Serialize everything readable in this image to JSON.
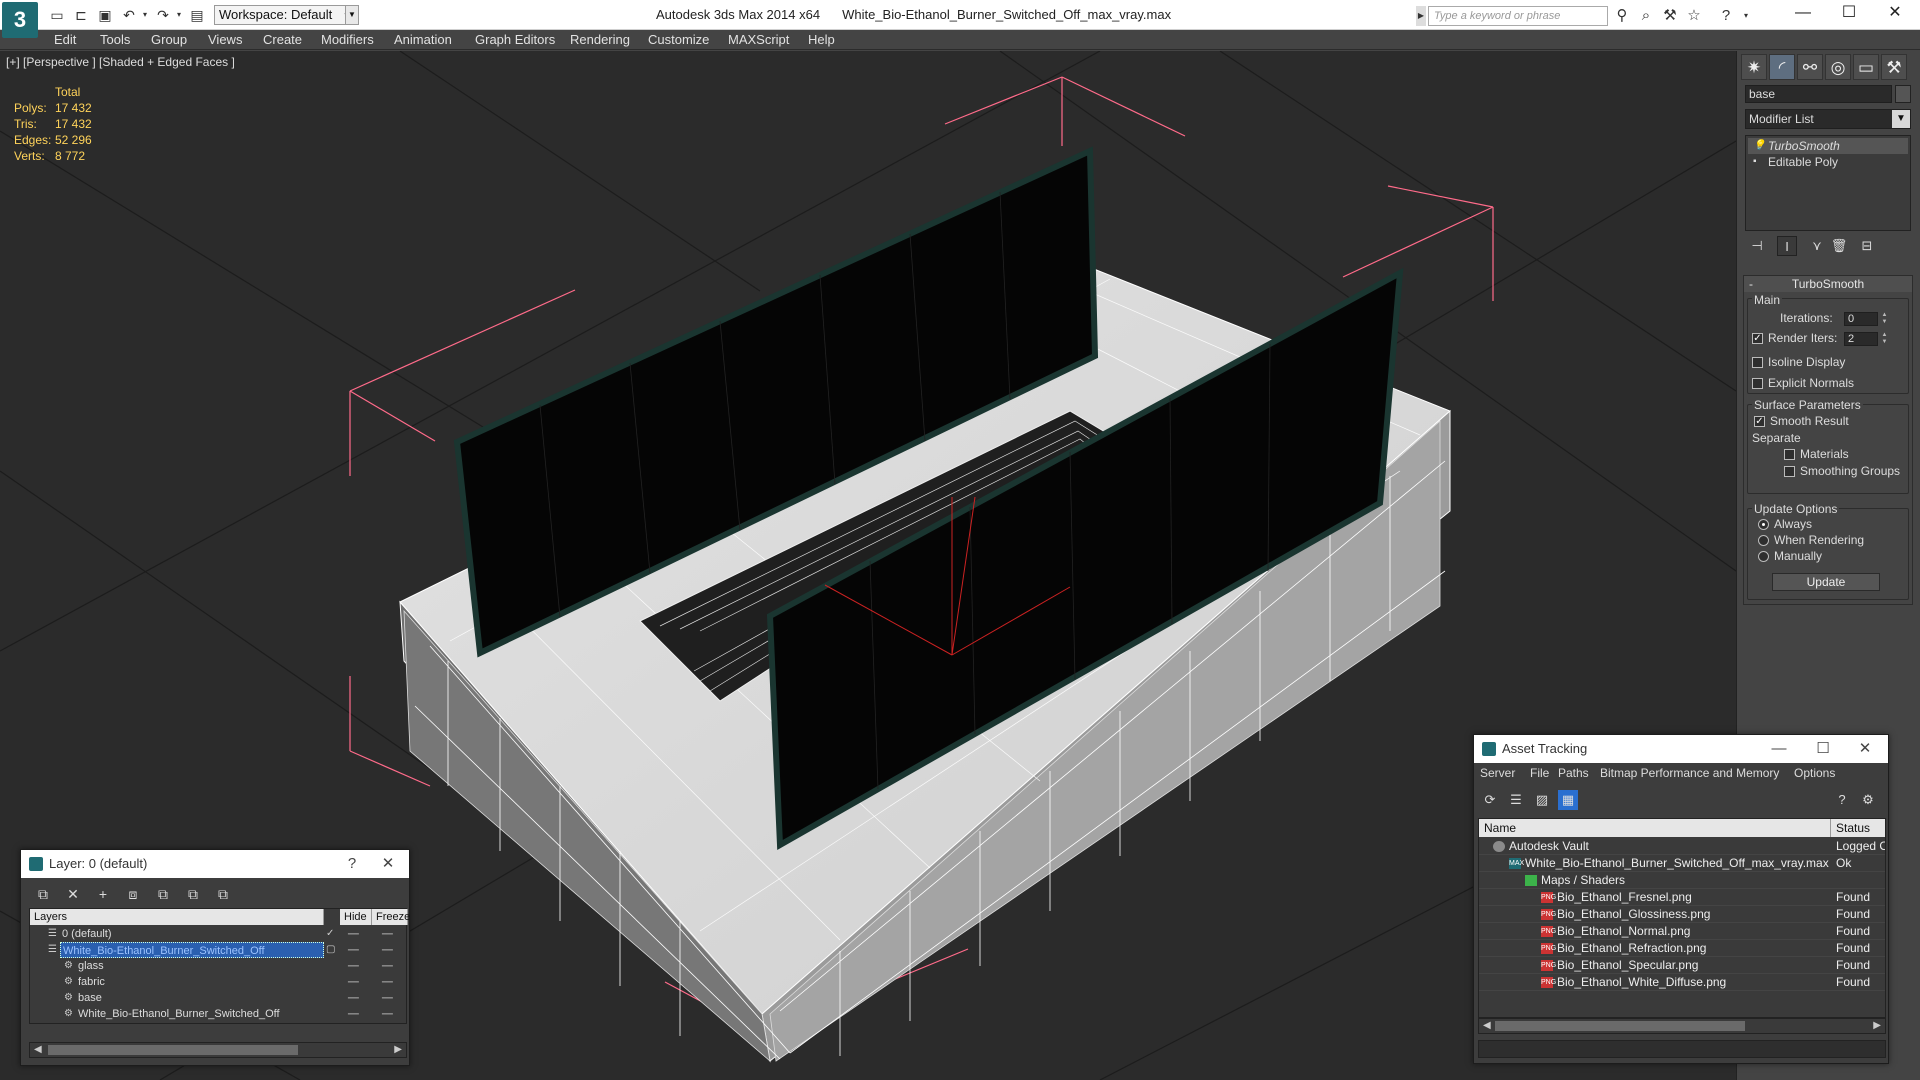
{
  "titlebar": {
    "workspace": "Workspace: Default",
    "app_name": "Autodesk 3ds Max  2014 x64",
    "file_name": "White_Bio-Ethanol_Burner_Switched_Off_max_vray.max",
    "search_placeholder": "Type a keyword or phrase",
    "minimize": "—",
    "maximize": "☐",
    "close": "✕"
  },
  "menu": [
    "Edit",
    "Tools",
    "Group",
    "Views",
    "Create",
    "Modifiers",
    "Animation",
    "Graph Editors",
    "Rendering",
    "Customize",
    "MAXScript",
    "Help"
  ],
  "viewport": {
    "label": "[+] [Perspective ] [Shaded + Edged Faces ]",
    "stats": {
      "header": "Total",
      "rows": [
        {
          "k": "Polys:",
          "v": "17 432"
        },
        {
          "k": "Tris:",
          "v": "17 432"
        },
        {
          "k": "Edges:",
          "v": "52 296"
        },
        {
          "k": "Verts:",
          "v": "8 772"
        }
      ]
    }
  },
  "command_panel": {
    "object_name": "base",
    "modifier_list": "Modifier List",
    "stack": [
      "TurboSmooth",
      "Editable Poly"
    ],
    "rollout_title": "TurboSmooth",
    "main_label": "Main",
    "iterations_label": "Iterations:",
    "iterations_value": "0",
    "render_iters_label": "Render Iters:",
    "render_iters_value": "2",
    "isoline_label": "Isoline Display",
    "explicit_normals_label": "Explicit Normals",
    "surface_params_label": "Surface Parameters",
    "smooth_result_label": "Smooth Result",
    "separate_label": "Separate",
    "materials_label": "Materials",
    "smoothing_groups_label": "Smoothing Groups",
    "update_options_label": "Update Options",
    "always_label": "Always",
    "when_rendering_label": "When Rendering",
    "manually_label": "Manually",
    "update_button": "Update"
  },
  "layer_window": {
    "title": "Layer: 0 (default)",
    "help": "?",
    "close": "✕",
    "col_layers": "Layers",
    "col_hide": "Hide",
    "col_freeze": "Freeze",
    "rows": [
      "0 (default)",
      "White_Bio-Ethanol_Burner_Switched_Off",
      "glass",
      "fabric",
      "base",
      "White_Bio-Ethanol_Burner_Switched_Off"
    ]
  },
  "asset_window": {
    "title": "Asset Tracking",
    "minimize": "—",
    "maximize": "☐",
    "close": "✕",
    "menu": [
      "Server",
      "File",
      "Paths",
      "Bitmap Performance and Memory",
      "Options"
    ],
    "col_name": "Name",
    "col_status": "Status",
    "rows": [
      {
        "name": "Autodesk Vault",
        "status": "Logged O"
      },
      {
        "name": "White_Bio-Ethanol_Burner_Switched_Off_max_vray.max",
        "status": "Ok"
      },
      {
        "name": "Maps / Shaders",
        "status": ""
      },
      {
        "name": "Bio_Ethanol_Fresnel.png",
        "status": "Found"
      },
      {
        "name": "Bio_Ethanol_Glossiness.png",
        "status": "Found"
      },
      {
        "name": "Bio_Ethanol_Normal.png",
        "status": "Found"
      },
      {
        "name": "Bio_Ethanol_Refraction.png",
        "status": "Found"
      },
      {
        "name": "Bio_Ethanol_Specular.png",
        "status": "Found"
      },
      {
        "name": "Bio_Ethanol_White_Diffuse.png",
        "status": "Found"
      }
    ]
  },
  "colors": {
    "viewport_bg": "#2b2b2b",
    "stats_text": "#ffd35a",
    "selection_blue": "#2a5fb0",
    "bbox_pink": "#ff6b8a"
  }
}
